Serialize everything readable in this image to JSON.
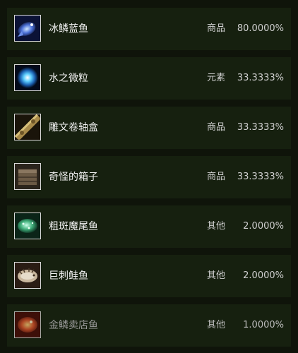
{
  "items": [
    {
      "name": "冰鳞蓝鱼",
      "type": "商品",
      "rate": "80.0000%",
      "icon": "blue-fish-icon"
    },
    {
      "name": "水之微粒",
      "type": "元素",
      "rate": "33.3333%",
      "icon": "water-particle-icon"
    },
    {
      "name": "雕文卷轴盒",
      "type": "商品",
      "rate": "33.3333%",
      "icon": "scroll-case-icon"
    },
    {
      "name": "奇怪的箱子",
      "type": "商品",
      "rate": "33.3333%",
      "icon": "crate-icon"
    },
    {
      "name": "粗斑魔尾鱼",
      "type": "其他",
      "rate": "2.0000%",
      "icon": "spotted-fish-icon"
    },
    {
      "name": "巨刺鲑鱼",
      "type": "其他",
      "rate": "2.0000%",
      "icon": "spiny-salmon-icon"
    },
    {
      "name": "金鳞卖店鱼",
      "type": "其他",
      "rate": "1.0000%",
      "icon": "golden-fish-icon"
    }
  ]
}
